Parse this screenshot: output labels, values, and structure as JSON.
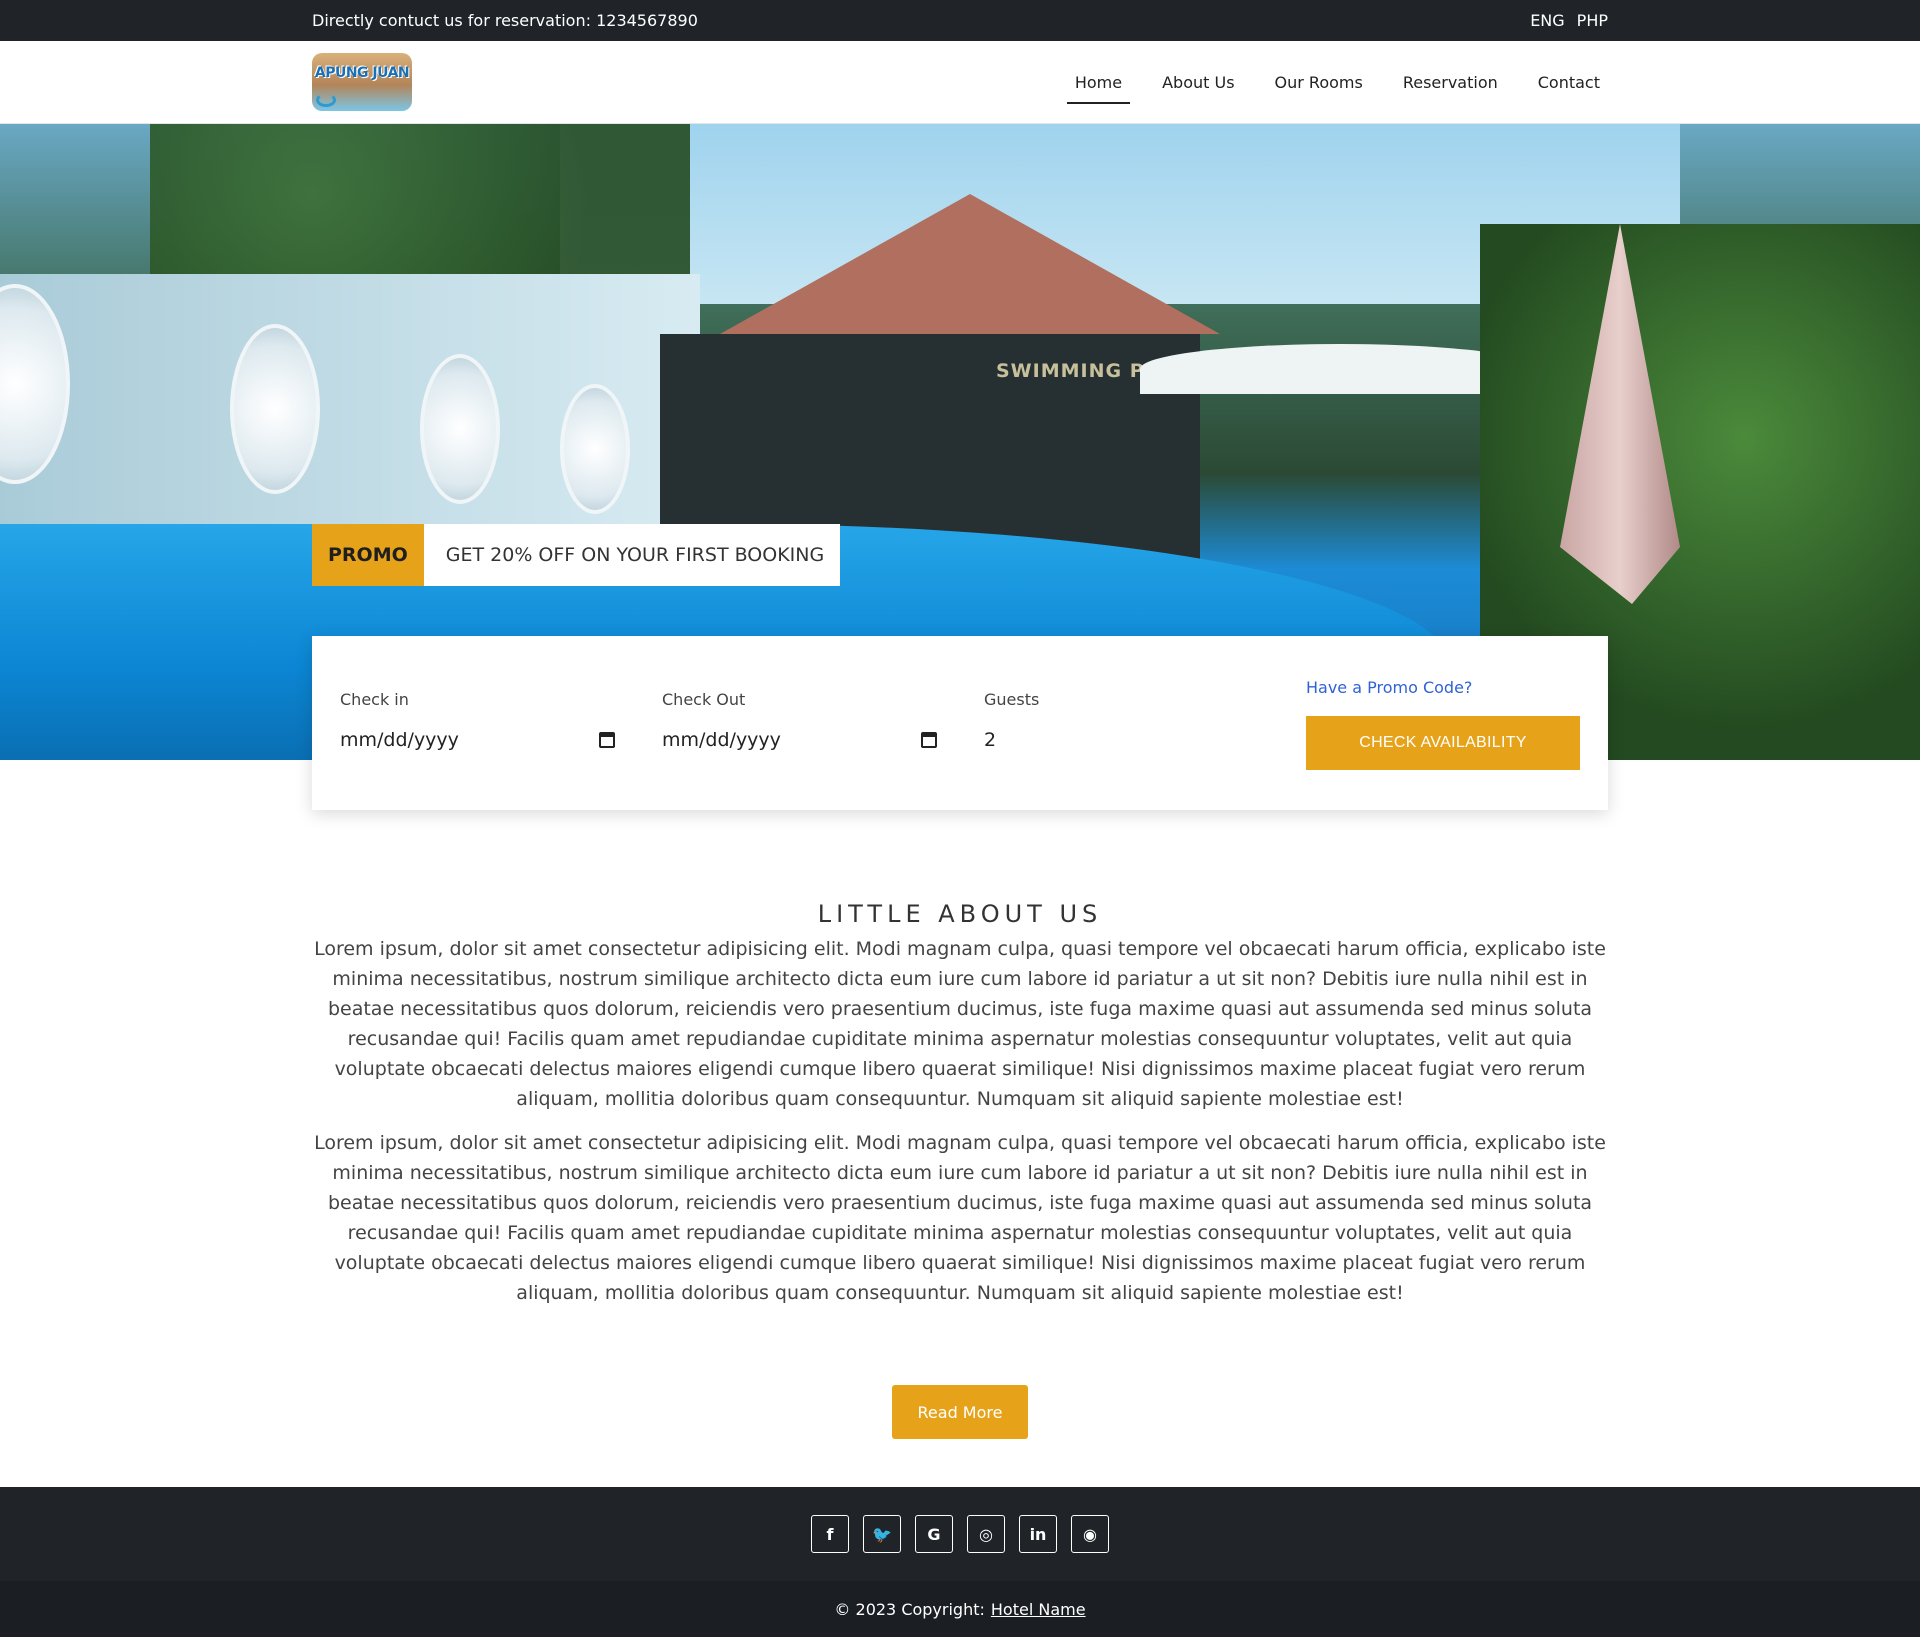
{
  "topbar": {
    "contact": "Directly contuct us for reservation: 1234567890",
    "languages": [
      "ENG",
      "PHP"
    ]
  },
  "logo": {
    "text": "APUNG JUAN"
  },
  "nav": {
    "items": [
      {
        "label": "Home",
        "active": true
      },
      {
        "label": "About Us"
      },
      {
        "label": "Our Rooms"
      },
      {
        "label": "Reservation"
      },
      {
        "label": "Contact"
      }
    ]
  },
  "hero": {
    "sign_text": "SWIMMING PO"
  },
  "promo": {
    "tag": "PROMO",
    "message": "GET 20% OFF ON YOUR FIRST BOOKING"
  },
  "booking": {
    "check_in_label": "Check in",
    "check_in_value": "mm/dd/yyyy",
    "check_out_label": "Check Out",
    "check_out_value": "mm/dd/yyyy",
    "guests_label": "Guests",
    "guests_value": "2",
    "promo_link": "Have a Promo Code?",
    "check_button": "CHECK AVAILABILITY"
  },
  "about": {
    "title": "LITTLE ABOUT US",
    "paragraphs": [
      "Lorem ipsum, dolor sit amet consectetur adipisicing elit. Modi magnam culpa, quasi tempore vel obcaecati harum officia, explicabo iste minima necessitatibus, nostrum similique architecto dicta eum iure cum labore id pariatur a ut sit non? Debitis iure nulla nihil est in beatae necessitatibus quos dolorum, reiciendis vero praesentium ducimus, iste fuga maxime quasi aut assumenda sed minus soluta recusandae qui! Facilis quam amet repudiandae cupiditate minima aspernatur molestias consequuntur voluptates, velit aut quia voluptate obcaecati delectus maiores eligendi cumque libero quaerat similique! Nisi dignissimos maxime placeat fugiat vero rerum aliquam, mollitia doloribus quam consequuntur. Numquam sit aliquid sapiente molestiae est!",
      "Lorem ipsum, dolor sit amet consectetur adipisicing elit. Modi magnam culpa, quasi tempore vel obcaecati harum officia, explicabo iste minima necessitatibus, nostrum similique architecto dicta eum iure cum labore id pariatur a ut sit non? Debitis iure nulla nihil est in beatae necessitatibus quos dolorum, reiciendis vero praesentium ducimus, iste fuga maxime quasi aut assumenda sed minus soluta recusandae qui! Facilis quam amet repudiandae cupiditate minima aspernatur molestias consequuntur voluptates, velit aut quia voluptate obcaecati delectus maiores eligendi cumque libero quaerat similique! Nisi dignissimos maxime placeat fugiat vero rerum aliquam, mollitia doloribus quam consequuntur. Numquam sit aliquid sapiente molestiae est!"
    ],
    "read_more": "Read More"
  },
  "footer": {
    "social": [
      {
        "name": "facebook-icon",
        "glyph": "f"
      },
      {
        "name": "twitter-icon",
        "glyph": "🐦"
      },
      {
        "name": "google-icon",
        "glyph": "G"
      },
      {
        "name": "instagram-icon",
        "glyph": "◎"
      },
      {
        "name": "linkedin-icon",
        "glyph": "in"
      },
      {
        "name": "github-icon",
        "glyph": "◉"
      }
    ],
    "copyright_prefix": "© 2023 Copyright:",
    "copyright_link": "Hotel Name"
  },
  "colors": {
    "accent": "#e6a31a",
    "dark": "#202429",
    "link": "#2f62d6"
  }
}
